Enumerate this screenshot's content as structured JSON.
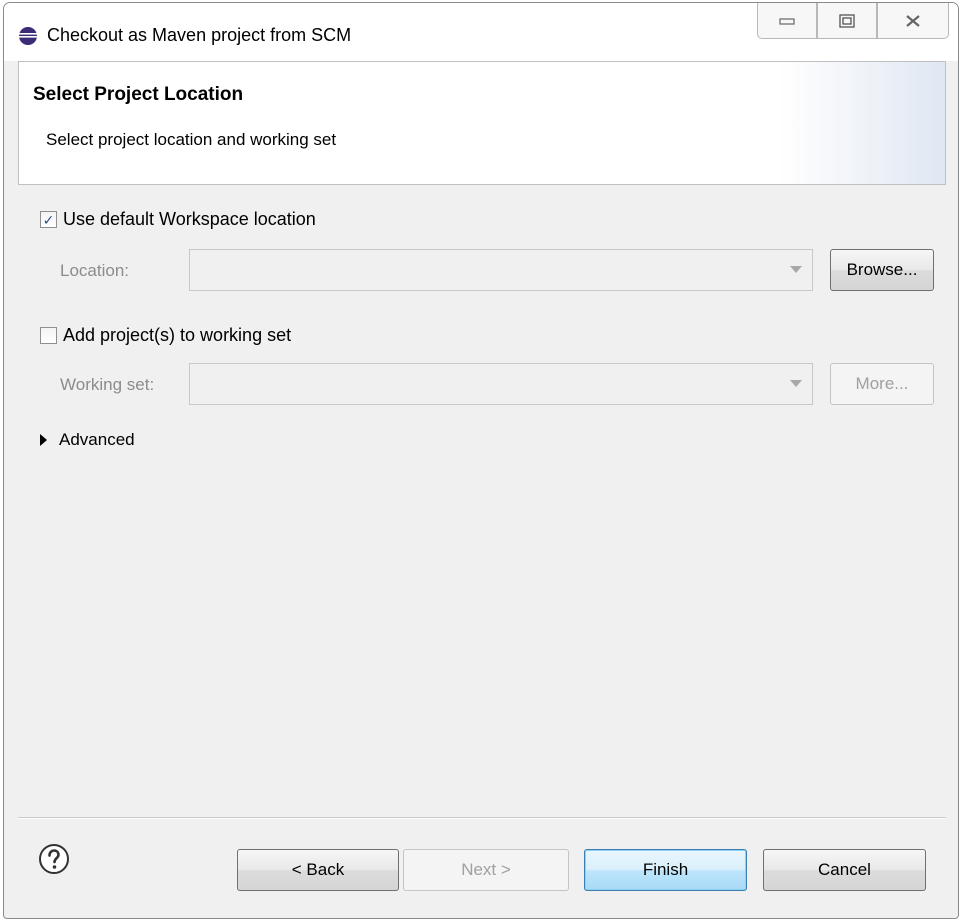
{
  "window": {
    "title": "Checkout as Maven project from SCM",
    "controls": {
      "minimize_icon": "minimize-icon",
      "maximize_icon": "maximize-icon",
      "close_icon": "close-icon"
    }
  },
  "header": {
    "title": "Select Project Location",
    "description": "Select project location and working set"
  },
  "form": {
    "use_default": {
      "label": "Use default Workspace location",
      "checked": true
    },
    "location": {
      "label": "Location:",
      "value": "",
      "browse_label": "Browse..."
    },
    "working_set_check": {
      "label": "Add project(s) to working set",
      "checked": false
    },
    "working_set": {
      "label": "Working set:",
      "value": "",
      "more_label": "More..."
    },
    "advanced": {
      "label": "Advanced"
    }
  },
  "footer": {
    "back_label": "< Back",
    "next_label": "Next >",
    "finish_label": "Finish",
    "cancel_label": "Cancel"
  },
  "colors": {
    "accent": "#3c7fb1",
    "disabled_text": "#8c8c8c",
    "dialog_bg": "#f0f0f0"
  }
}
